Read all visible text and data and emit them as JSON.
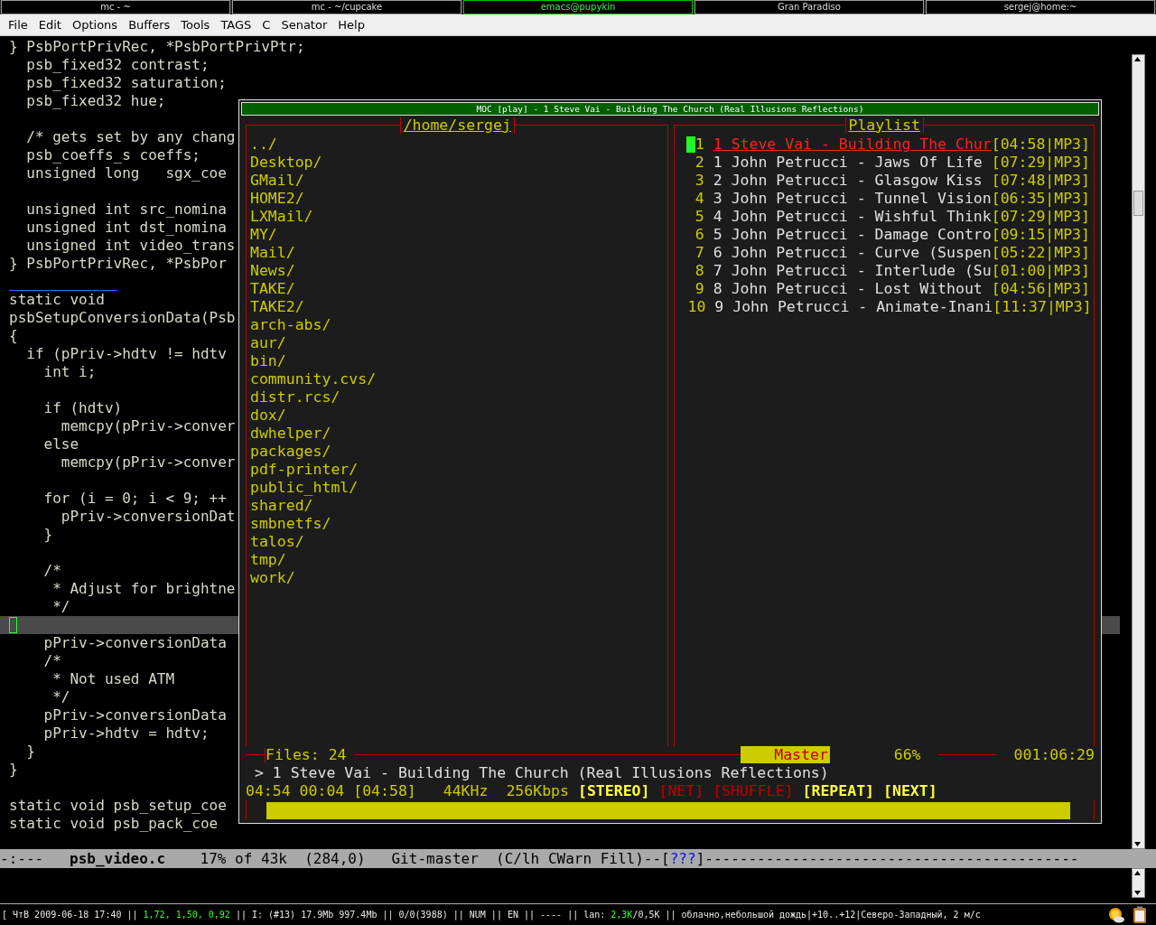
{
  "taskbar": [
    {
      "label": "mc - ~",
      "selected": false
    },
    {
      "label": "mc - ~/cupcake",
      "selected": false
    },
    {
      "label": "emacs@pupykin",
      "selected": true
    },
    {
      "label": "Gran Paradiso",
      "selected": false
    },
    {
      "label": "sergej@home:~",
      "selected": false
    }
  ],
  "menu": [
    "File",
    "Edit",
    "Options",
    "Buffers",
    "Tools",
    "TAGS",
    "C",
    "Senator",
    "Help"
  ],
  "editor": {
    "lines": [
      {
        "kind": "code",
        "text": "} PsbPortPrivRec, *PsbPortPrivPtr;",
        "current": false
      },
      {
        "kind": "code",
        "text": "  psb_fixed32 contrast;",
        "current": false
      },
      {
        "kind": "code",
        "text": "  psb_fixed32 saturation;",
        "current": false
      },
      {
        "kind": "code",
        "text": "  psb_fixed32 hue;",
        "current": false
      },
      {
        "kind": "code",
        "current": false
      },
      {
        "kind": "code",
        "text": "  /* gets set by any chang",
        "current": false
      },
      {
        "kind": "code",
        "text": "  psb_coeffs_s coeffs;",
        "current": false
      },
      {
        "kind": "code",
        "text": "  unsigned long   sgx_coe",
        "current": false
      },
      {
        "kind": "code",
        "current": false
      },
      {
        "kind": "code",
        "text": "  unsigned int src_nomina",
        "current": false
      },
      {
        "kind": "code",
        "text": "  unsigned int dst_nomina",
        "current": false
      },
      {
        "kind": "code",
        "text": "  unsigned int video_trans",
        "current": false
      },
      {
        "kind": "code",
        "text": "} PsbPortPrivRec, *PsbPor",
        "current": false
      },
      {
        "kind": "page-break",
        "current": false
      },
      {
        "kind": "code",
        "text": "static void",
        "current": false
      },
      {
        "kind": "code",
        "text": "psbSetupConversionData(Psb",
        "current": false
      },
      {
        "kind": "code",
        "text": "{",
        "current": false
      },
      {
        "kind": "code",
        "text": "  if (pPriv->hdtv != hdtv",
        "current": false
      },
      {
        "kind": "code",
        "text": "    int i;",
        "current": false
      },
      {
        "kind": "code",
        "current": false
      },
      {
        "kind": "code",
        "text": "    if (hdtv)",
        "current": false
      },
      {
        "kind": "code",
        "text": "      memcpy(pPriv->conver",
        "current": false
      },
      {
        "kind": "code",
        "text": "    else",
        "current": false
      },
      {
        "kind": "code",
        "text": "      memcpy(pPriv->conver",
        "current": false
      },
      {
        "kind": "code",
        "current": false
      },
      {
        "kind": "code",
        "text": "    for (i = 0; i < 9; ++",
        "current": false
      },
      {
        "kind": "code",
        "text": "      pPriv->conversionDat",
        "current": false
      },
      {
        "kind": "code",
        "text": "    }",
        "current": false
      },
      {
        "kind": "code",
        "current": false
      },
      {
        "kind": "code",
        "text": "    /*",
        "current": false
      },
      {
        "kind": "code",
        "text": "     * Adjust for brightne",
        "current": false
      },
      {
        "kind": "code",
        "text": "     */",
        "current": false
      },
      {
        "kind": "code",
        "current": true
      },
      {
        "kind": "code",
        "text": "    pPriv->conversionData",
        "current": false
      },
      {
        "kind": "code",
        "text": "    /*",
        "current": false
      },
      {
        "kind": "code",
        "text": "     * Not used ATM",
        "current": false
      },
      {
        "kind": "code",
        "text": "     */",
        "current": false
      },
      {
        "kind": "code",
        "text": "    pPriv->conversionData",
        "current": false
      },
      {
        "kind": "code",
        "text": "    pPriv->hdtv = hdtv;",
        "current": false
      },
      {
        "kind": "code",
        "text": "  }",
        "current": false
      },
      {
        "kind": "code",
        "text": "}",
        "current": false
      },
      {
        "kind": "code",
        "current": false
      },
      {
        "kind": "code",
        "text": "static void psb_setup_coe",
        "current": false
      },
      {
        "kind": "code",
        "text": "static void psb_pack_coe",
        "current": false
      }
    ]
  },
  "mode_line": {
    "state": "-:---",
    "buffer": "psb_video.c",
    "position": "17% of 43k",
    "cursor": "(284,0)",
    "vc": "Git-master",
    "modes": "(C/lh CWarn Fill)--[",
    "tag": "???",
    "tail": "]-------------------------------------------"
  },
  "moc": {
    "title": "MOC [play] - 1 Steve Vai - Building The Church (Real Illusions Reflections)",
    "files_title": "/home/sergej",
    "files": [
      "../",
      "Desktop/",
      "GMail/",
      "HOME2/",
      "LXMail/",
      "MY/",
      "Mail/",
      "News/",
      "TAKE/",
      "TAKE2/",
      "arch-abs/",
      "aur/",
      "bin/",
      "community.cvs/",
      "distr.rcs/",
      "dox/",
      "dwhelper/",
      "packages/",
      "pdf-printer/",
      "public_html/",
      "shared/",
      "smbnetfs/",
      "talos/",
      "tmp/",
      "work/"
    ],
    "playlist_title": "Playlist",
    "playlist": [
      {
        "num": "1",
        "title": "1 Steve Vai - Building The Chur",
        "time": "[04:58|MP3]",
        "selected": true
      },
      {
        "num": "2",
        "title": "1 John Petrucci - Jaws Of Life ",
        "time": "[07:29|MP3]",
        "selected": false
      },
      {
        "num": "3",
        "title": "2 John Petrucci - Glasgow Kiss ",
        "time": "[07:48|MP3]",
        "selected": false
      },
      {
        "num": "4",
        "title": "3 John Petrucci - Tunnel Vision",
        "time": "[06:35|MP3]",
        "selected": false
      },
      {
        "num": "5",
        "title": "4 John Petrucci - Wishful Think",
        "time": "[07:29|MP3]",
        "selected": false
      },
      {
        "num": "6",
        "title": "5 John Petrucci - Damage Contro",
        "time": "[09:15|MP3]",
        "selected": false
      },
      {
        "num": "7",
        "title": "6 John Petrucci - Curve (Suspen",
        "time": "[05:22|MP3]",
        "selected": false
      },
      {
        "num": "8",
        "title": "7 John Petrucci - Interlude (Su",
        "time": "[01:00|MP3]",
        "selected": false
      },
      {
        "num": "9",
        "title": "8 John Petrucci - Lost Without ",
        "time": "[04:56|MP3]",
        "selected": false
      },
      {
        "num": "10",
        "title": "9 John Petrucci - Animate-Inani",
        "time": "[11:37|MP3]",
        "selected": false
      }
    ],
    "files_count": "Files: 24",
    "mixer": {
      "label": "Master",
      "level": 0.66,
      "reading": "66%"
    },
    "total_time": "001:06:29",
    "now_playing": "> 1 Steve Vai - Building The Church (Real Illusions Reflections)",
    "times": "04:54 00:04 [04:58]",
    "rate": "44KHz",
    "bitrate": "256Kbps",
    "flags": [
      {
        "label": "[STEREO]",
        "on": true
      },
      {
        "label": "[NET]",
        "on": false
      },
      {
        "label": "[SHUFFLE]",
        "on": false
      },
      {
        "label": "[REPEAT]",
        "on": true
      },
      {
        "label": "[NEXT]",
        "on": true
      }
    ],
    "progress": {
      "level": 0.985
    }
  },
  "status_bar": [
    {
      "text": "[ ЧтВ 2009-06-18 17:40 || ",
      "highlight": false
    },
    {
      "text": "1,72, 1,50, 0,92",
      "highlight": true
    },
    {
      "text": " || I: (#13) 17.9Mb 997.4Mb || 0/0(3988) || NUM || EN || ---- || lan: ",
      "highlight": false
    },
    {
      "text": "2,3K",
      "highlight": true
    },
    {
      "text": "/0,5K || облачно,небольшой дождь|+10..+12|Северо-Западный, 2 м/с",
      "highlight": false
    }
  ]
}
